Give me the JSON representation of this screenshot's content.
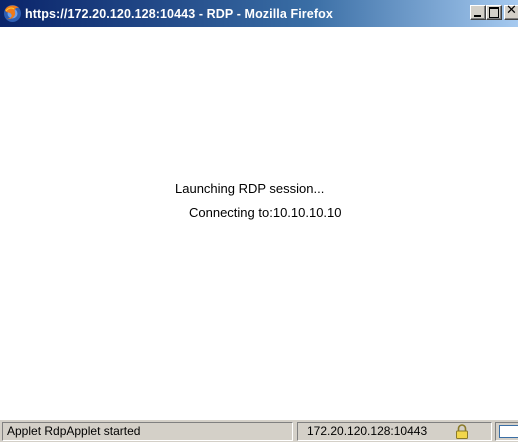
{
  "window": {
    "title": "https://172.20.120.128:10443 - RDP - Mozilla Firefox",
    "app_icon": "firefox-icon",
    "buttons": {
      "minimize_icon": "minimize-icon",
      "maximize_icon": "maximize-icon",
      "close_icon": "close-icon",
      "close_glyph": "✕"
    }
  },
  "content": {
    "launching_text": "Launching RDP session...",
    "connecting_text": "Connecting to:10.10.10.10"
  },
  "statusbar": {
    "status_text": "Applet RdpApplet started",
    "host_text": "172.20.120.128:10443",
    "lock_icon": "lock-icon",
    "extra_icon": "window-icon"
  },
  "colors": {
    "titlebar_start": "#0a246a",
    "titlebar_end": "#a6caf0",
    "chrome": "#d4d0c8",
    "content_bg": "#ffffff"
  }
}
